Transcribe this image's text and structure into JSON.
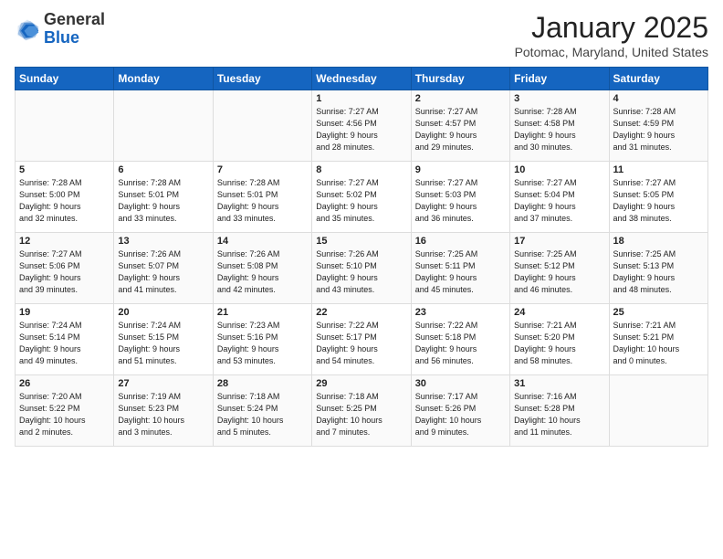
{
  "header": {
    "logo_general": "General",
    "logo_blue": "Blue",
    "month_title": "January 2025",
    "location": "Potomac, Maryland, United States"
  },
  "days_of_week": [
    "Sunday",
    "Monday",
    "Tuesday",
    "Wednesday",
    "Thursday",
    "Friday",
    "Saturday"
  ],
  "weeks": [
    [
      {
        "day": "",
        "info": ""
      },
      {
        "day": "",
        "info": ""
      },
      {
        "day": "",
        "info": ""
      },
      {
        "day": "1",
        "info": "Sunrise: 7:27 AM\nSunset: 4:56 PM\nDaylight: 9 hours\nand 28 minutes."
      },
      {
        "day": "2",
        "info": "Sunrise: 7:27 AM\nSunset: 4:57 PM\nDaylight: 9 hours\nand 29 minutes."
      },
      {
        "day": "3",
        "info": "Sunrise: 7:28 AM\nSunset: 4:58 PM\nDaylight: 9 hours\nand 30 minutes."
      },
      {
        "day": "4",
        "info": "Sunrise: 7:28 AM\nSunset: 4:59 PM\nDaylight: 9 hours\nand 31 minutes."
      }
    ],
    [
      {
        "day": "5",
        "info": "Sunrise: 7:28 AM\nSunset: 5:00 PM\nDaylight: 9 hours\nand 32 minutes."
      },
      {
        "day": "6",
        "info": "Sunrise: 7:28 AM\nSunset: 5:01 PM\nDaylight: 9 hours\nand 33 minutes."
      },
      {
        "day": "7",
        "info": "Sunrise: 7:28 AM\nSunset: 5:01 PM\nDaylight: 9 hours\nand 33 minutes."
      },
      {
        "day": "8",
        "info": "Sunrise: 7:27 AM\nSunset: 5:02 PM\nDaylight: 9 hours\nand 35 minutes."
      },
      {
        "day": "9",
        "info": "Sunrise: 7:27 AM\nSunset: 5:03 PM\nDaylight: 9 hours\nand 36 minutes."
      },
      {
        "day": "10",
        "info": "Sunrise: 7:27 AM\nSunset: 5:04 PM\nDaylight: 9 hours\nand 37 minutes."
      },
      {
        "day": "11",
        "info": "Sunrise: 7:27 AM\nSunset: 5:05 PM\nDaylight: 9 hours\nand 38 minutes."
      }
    ],
    [
      {
        "day": "12",
        "info": "Sunrise: 7:27 AM\nSunset: 5:06 PM\nDaylight: 9 hours\nand 39 minutes."
      },
      {
        "day": "13",
        "info": "Sunrise: 7:26 AM\nSunset: 5:07 PM\nDaylight: 9 hours\nand 41 minutes."
      },
      {
        "day": "14",
        "info": "Sunrise: 7:26 AM\nSunset: 5:08 PM\nDaylight: 9 hours\nand 42 minutes."
      },
      {
        "day": "15",
        "info": "Sunrise: 7:26 AM\nSunset: 5:10 PM\nDaylight: 9 hours\nand 43 minutes."
      },
      {
        "day": "16",
        "info": "Sunrise: 7:25 AM\nSunset: 5:11 PM\nDaylight: 9 hours\nand 45 minutes."
      },
      {
        "day": "17",
        "info": "Sunrise: 7:25 AM\nSunset: 5:12 PM\nDaylight: 9 hours\nand 46 minutes."
      },
      {
        "day": "18",
        "info": "Sunrise: 7:25 AM\nSunset: 5:13 PM\nDaylight: 9 hours\nand 48 minutes."
      }
    ],
    [
      {
        "day": "19",
        "info": "Sunrise: 7:24 AM\nSunset: 5:14 PM\nDaylight: 9 hours\nand 49 minutes."
      },
      {
        "day": "20",
        "info": "Sunrise: 7:24 AM\nSunset: 5:15 PM\nDaylight: 9 hours\nand 51 minutes."
      },
      {
        "day": "21",
        "info": "Sunrise: 7:23 AM\nSunset: 5:16 PM\nDaylight: 9 hours\nand 53 minutes."
      },
      {
        "day": "22",
        "info": "Sunrise: 7:22 AM\nSunset: 5:17 PM\nDaylight: 9 hours\nand 54 minutes."
      },
      {
        "day": "23",
        "info": "Sunrise: 7:22 AM\nSunset: 5:18 PM\nDaylight: 9 hours\nand 56 minutes."
      },
      {
        "day": "24",
        "info": "Sunrise: 7:21 AM\nSunset: 5:20 PM\nDaylight: 9 hours\nand 58 minutes."
      },
      {
        "day": "25",
        "info": "Sunrise: 7:21 AM\nSunset: 5:21 PM\nDaylight: 10 hours\nand 0 minutes."
      }
    ],
    [
      {
        "day": "26",
        "info": "Sunrise: 7:20 AM\nSunset: 5:22 PM\nDaylight: 10 hours\nand 2 minutes."
      },
      {
        "day": "27",
        "info": "Sunrise: 7:19 AM\nSunset: 5:23 PM\nDaylight: 10 hours\nand 3 minutes."
      },
      {
        "day": "28",
        "info": "Sunrise: 7:18 AM\nSunset: 5:24 PM\nDaylight: 10 hours\nand 5 minutes."
      },
      {
        "day": "29",
        "info": "Sunrise: 7:18 AM\nSunset: 5:25 PM\nDaylight: 10 hours\nand 7 minutes."
      },
      {
        "day": "30",
        "info": "Sunrise: 7:17 AM\nSunset: 5:26 PM\nDaylight: 10 hours\nand 9 minutes."
      },
      {
        "day": "31",
        "info": "Sunrise: 7:16 AM\nSunset: 5:28 PM\nDaylight: 10 hours\nand 11 minutes."
      },
      {
        "day": "",
        "info": ""
      }
    ]
  ]
}
